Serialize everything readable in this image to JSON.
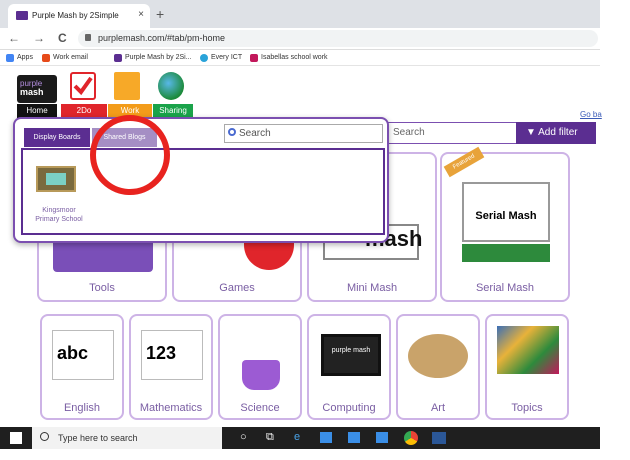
{
  "browser": {
    "tab_title": "Purple Mash by 2Simple",
    "tab_close": "×",
    "new_tab": "+",
    "back": "←",
    "forward": "→",
    "reload": "C",
    "url": "purplemash.com/#tab/pm-home"
  },
  "bookmarks": [
    {
      "label": "Apps",
      "color": "#4285f4"
    },
    {
      "label": "Work email",
      "color": "#e64a19"
    },
    {
      "label": "Purple Mash by 2Si...",
      "color": "#5b2e91"
    },
    {
      "label": "Every ICT",
      "color": "#29a3d9"
    },
    {
      "label": "Isabellas school work",
      "color": "#c2185b"
    }
  ],
  "logo": {
    "line1": "purple",
    "line2": "mash"
  },
  "nav_tabs": [
    {
      "label": "Home",
      "color": "#111111"
    },
    {
      "label": "2Do",
      "color": "#e0252b"
    },
    {
      "label": "Work",
      "color": "#f39c1a"
    },
    {
      "label": "Sharing",
      "color": "#1aa34a"
    }
  ],
  "go_back": "Go ba",
  "search": {
    "placeholder": "Search"
  },
  "add_filter": "Add filter",
  "cards_row1": [
    {
      "label": "Tools"
    },
    {
      "label": "Games"
    },
    {
      "label": "Mini Mash"
    },
    {
      "label": "Serial Mash"
    }
  ],
  "serial_mash_badge": "Featured",
  "serial_mash_book_title": "Serial Mash",
  "mini_mash_text": "mash",
  "cards_row2": [
    {
      "label": "English"
    },
    {
      "label": "Mathematics"
    },
    {
      "label": "Science"
    },
    {
      "label": "Computing"
    },
    {
      "label": "Art"
    },
    {
      "label": "Topics"
    }
  ],
  "english_art": "abc",
  "maths_art": "123",
  "computing_screen": "purple mash",
  "popup": {
    "tab_display_boards": "Display Boards",
    "tab_shared_blogs": "Shared Blogs",
    "search_placeholder": "Search",
    "item": {
      "line1": "Kingsmoor",
      "line2": "Primary School"
    }
  },
  "taskbar": {
    "search_placeholder": "Type here to search"
  }
}
